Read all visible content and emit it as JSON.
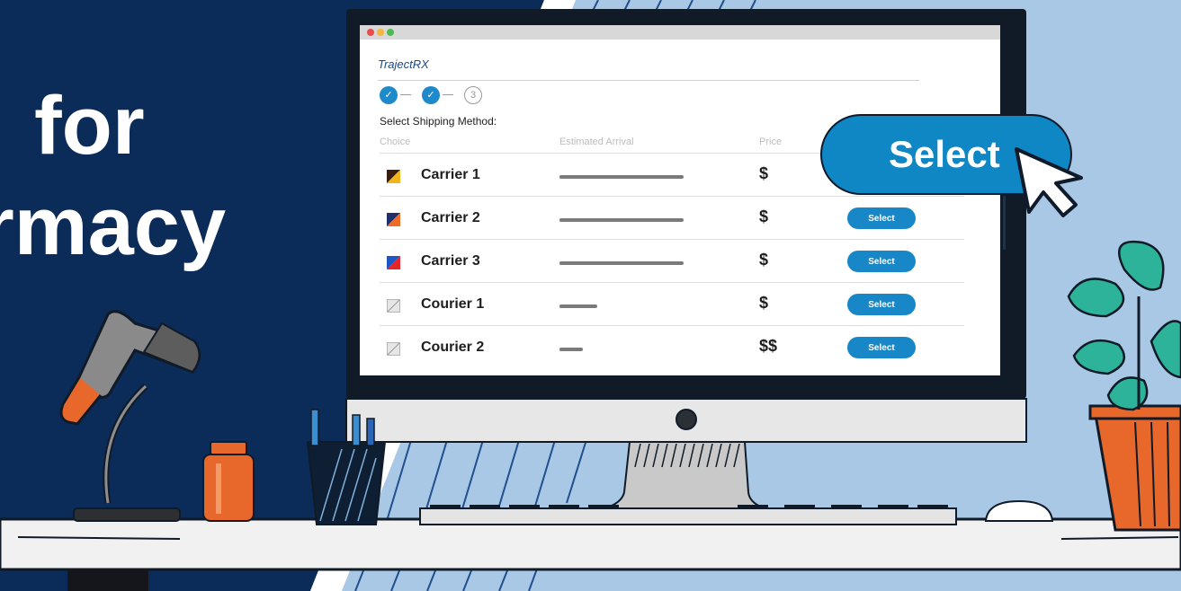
{
  "headline": {
    "line1": "for",
    "line2": "rmacy"
  },
  "app": {
    "brand": "TrajectRX"
  },
  "stepper": {
    "steps": [
      "✓",
      "✓",
      "3"
    ]
  },
  "form": {
    "section_title": "Select Shipping Method:",
    "columns": [
      "Choice",
      "Estimated Arrival",
      "Price",
      ""
    ]
  },
  "rows": [
    {
      "name": "Carrier 1",
      "price": "$",
      "action": "Select",
      "swatch": [
        "#3a1c10",
        "#f2b41c"
      ],
      "eta_fraction": 1.0
    },
    {
      "name": "Carrier 2",
      "price": "$",
      "action": "Select",
      "swatch": [
        "#1e2f6a",
        "#ef6b2a"
      ],
      "eta_fraction": 1.0
    },
    {
      "name": "Carrier 3",
      "price": "$",
      "action": "Select",
      "swatch": [
        "#1e56c6",
        "#e6252a"
      ],
      "eta_fraction": 1.0
    },
    {
      "name": "Courier 1",
      "price": "$",
      "action": "Select",
      "swatch": [
        "#e6e6e6",
        "#b4b4b4"
      ],
      "eta_fraction": 0.3
    },
    {
      "name": "Courier 2",
      "price": "$$",
      "action": "Select",
      "swatch": [
        "#e6e6e6",
        "#b4b4b4"
      ],
      "eta_fraction": 0.19
    }
  ],
  "highlight": {
    "label": "Select"
  },
  "colors": {
    "navy_bg": "#0b2b58",
    "light_bg": "#a9c8e6",
    "accent_blue": "#1787c7",
    "plant_green": "#2db39a",
    "pot_orange": "#e8672a"
  },
  "icons": {
    "cursor": "arrow-cursor-icon",
    "scanner": "barcode-scanner-icon",
    "bottle": "pill-bottle-icon",
    "plant": "potted-plant-icon",
    "mouse": "computer-mouse-icon",
    "pens": "pen-cup-icon"
  }
}
